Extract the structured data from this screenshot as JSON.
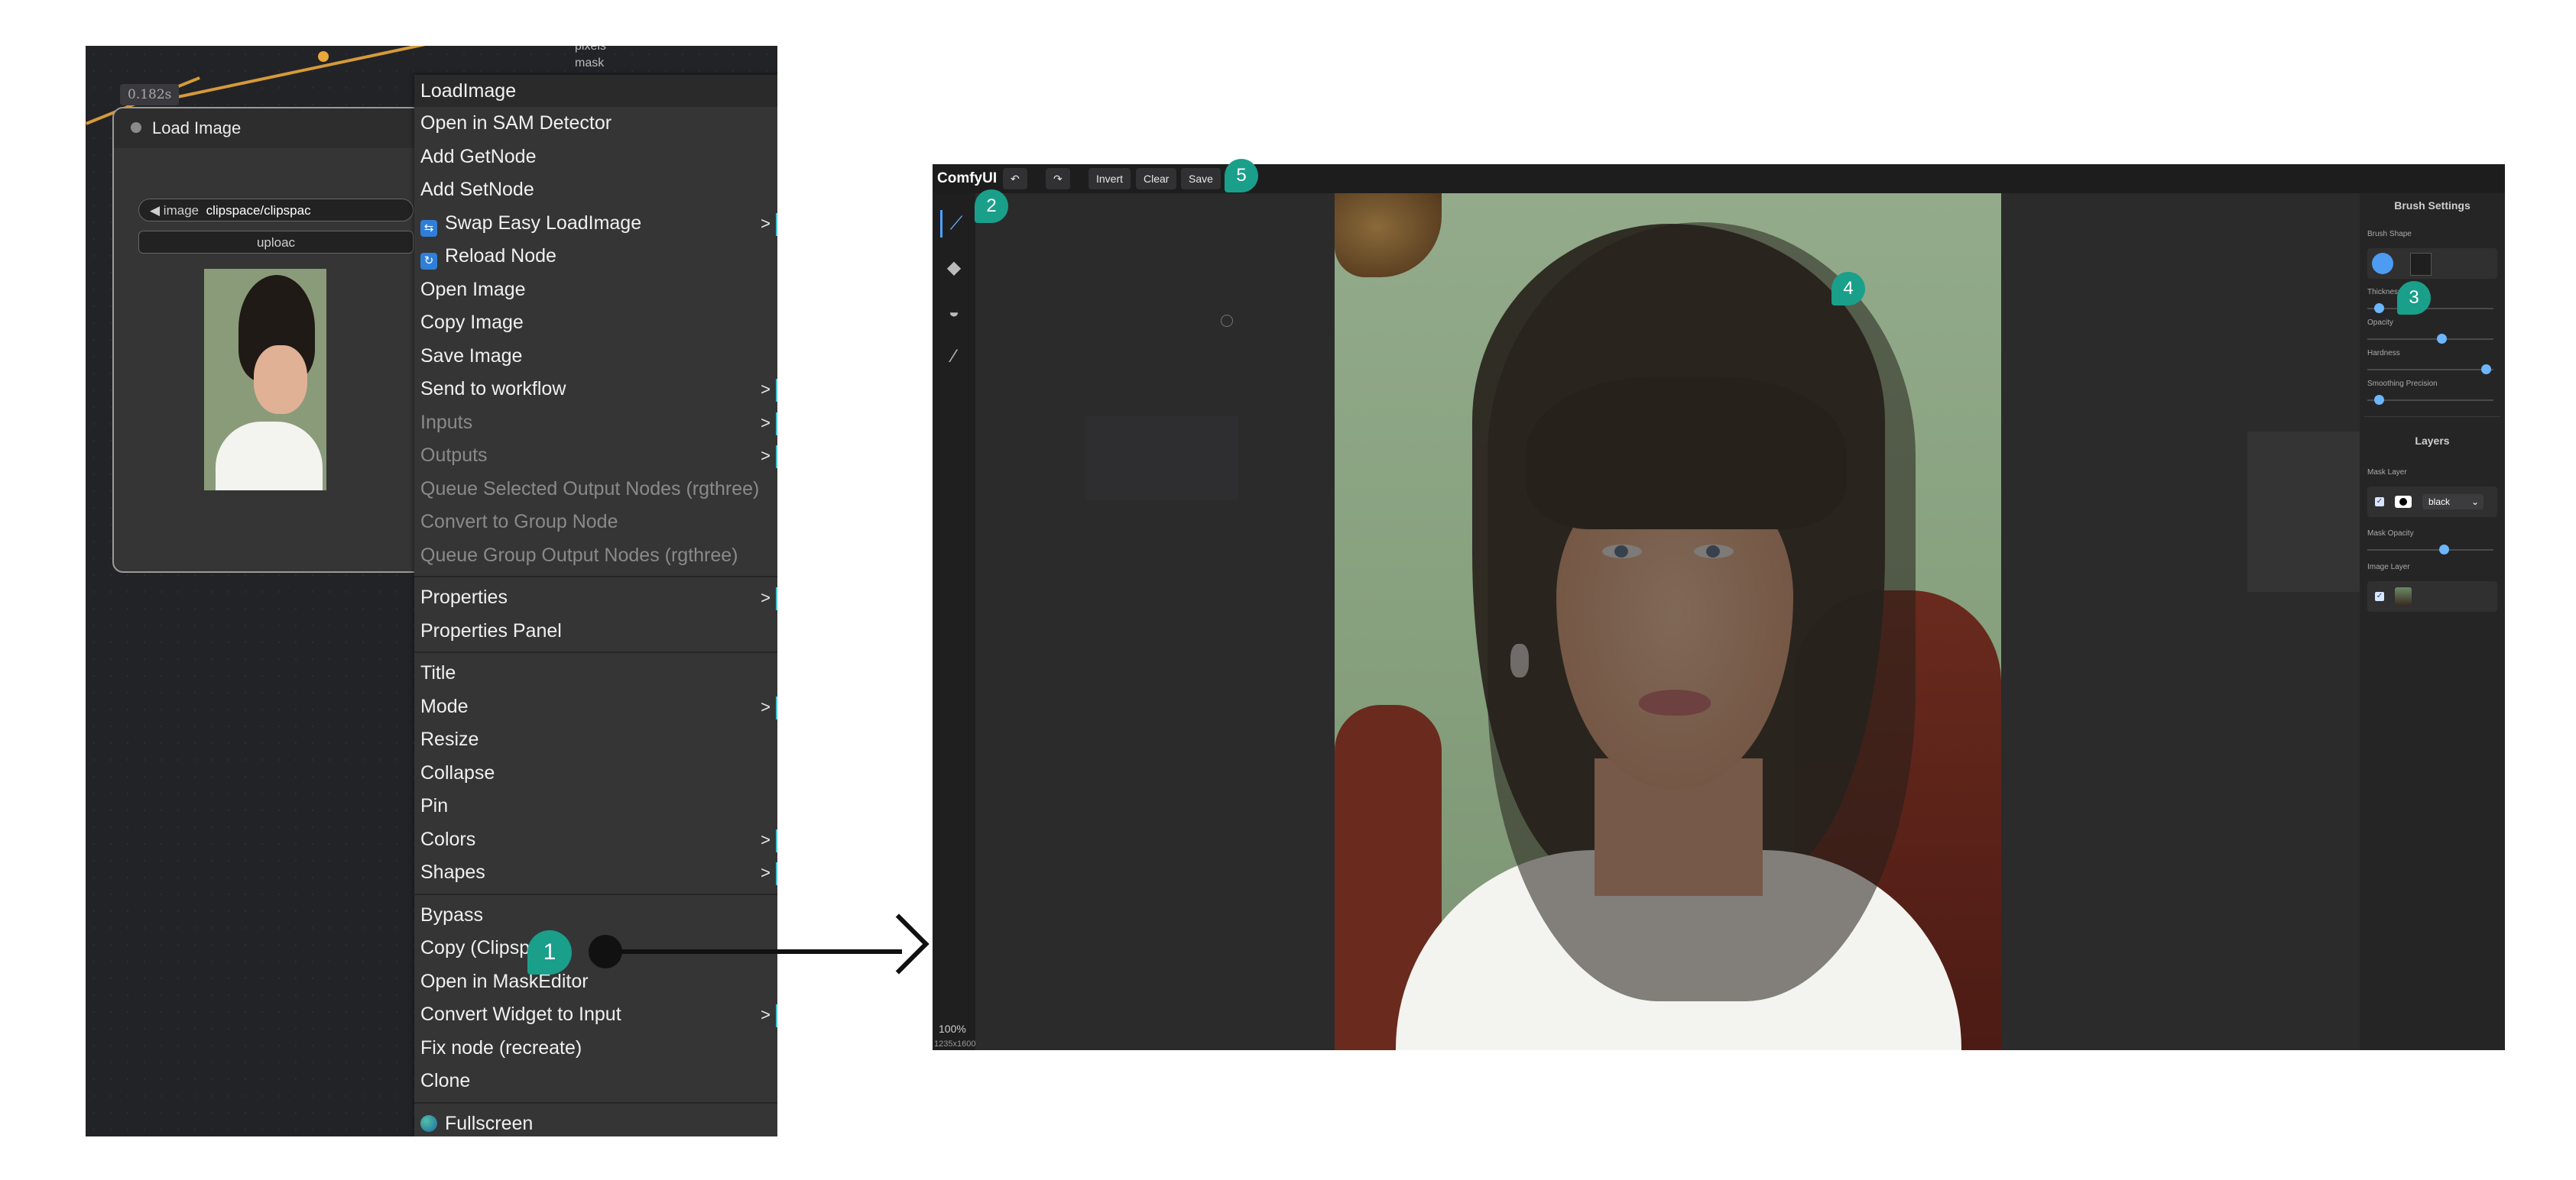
{
  "node_editor": {
    "time_badge": "0.182s",
    "node_title": "Load Image",
    "image_widget_label": "image",
    "image_widget_value": "clipspace/clipspac",
    "upload_label": "uploac",
    "top_node_labels": [
      "pixels",
      "mask"
    ]
  },
  "context_menu": {
    "title": "LoadImage",
    "items": [
      "Open in SAM Detector",
      "Add GetNode",
      "Add SetNode",
      "Swap Easy LoadImage",
      "Reload Node",
      "Open Image",
      "Copy Image",
      "Save Image",
      "Send to workflow",
      "Inputs",
      "Outputs",
      "Queue Selected Output Nodes (rgthree)",
      "Convert to Group Node",
      "Queue Group Output Nodes (rgthree)",
      "Properties",
      "Properties Panel",
      "Title",
      "Mode",
      "Resize",
      "Collapse",
      "Pin",
      "Colors",
      "Shapes",
      "Bypass",
      "Copy (Clipspace)",
      "Open in MaskEditor",
      "Convert Widget to Input",
      "Fix node (recreate)",
      "Clone",
      "Fullscreen"
    ],
    "submenu_arrow": ">"
  },
  "callouts": [
    "1",
    "2",
    "3",
    "4",
    "5"
  ],
  "mask_editor": {
    "brand": "ComfyUI",
    "buttons": {
      "undo": "↶",
      "redo": "↷",
      "invert": "Invert",
      "clear": "Clear",
      "save": "Save",
      "cancel_fragment": "el"
    },
    "zoom": "100%",
    "image_size": "1235x1600",
    "panel": {
      "brush_settings_title": "Brush Settings",
      "brush_shape_label": "Brush Shape",
      "thickness_label": "Thickness",
      "opacity_label": "Opacity",
      "hardness_label": "Hardness",
      "smoothing_label": "Smoothing Precision",
      "layers_title": "Layers",
      "mask_layer_label": "Mask Layer",
      "mask_color_value": "black",
      "mask_opacity_label": "Mask Opacity",
      "image_layer_label": "Image Layer"
    },
    "slider_levels": {
      "thickness": 0.06,
      "opacity": 0.6,
      "hardness": 0.98,
      "smoothing": 0.06,
      "mask_opacity": 0.62
    },
    "colors": {
      "accent": "#4c9cf2",
      "callout": "#1a9f8b",
      "menu_submenu_bar": "#46c6d8"
    }
  }
}
